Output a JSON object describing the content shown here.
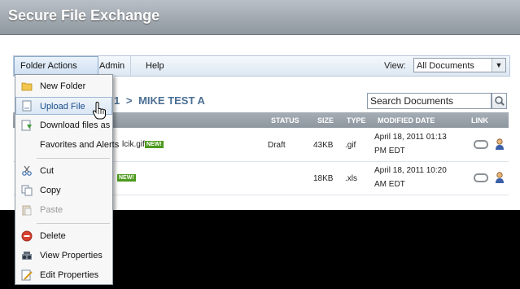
{
  "app": {
    "title": "Secure File Exchange"
  },
  "menubar": {
    "items": [
      {
        "label": "Folder Actions"
      },
      {
        "label": "Admin"
      },
      {
        "label": "Help"
      }
    ],
    "view_label": "View:",
    "view_selected": "All Documents"
  },
  "breadcrumb": {
    "part1": "1",
    "sep": ">",
    "folder": "MIKE TEST A"
  },
  "search": {
    "value": "Search Documents"
  },
  "table": {
    "headers": {
      "status": "STATUS",
      "size": "SIZE",
      "type": "TYPE",
      "modified": "MODIFIED DATE",
      "link": "LINK"
    },
    "rows": [
      {
        "name_fragment": "lcik.gif",
        "badge": "NEW!",
        "status": "Draft",
        "size": "43KB",
        "type": ".gif",
        "date1": "April 18, 2011 01:13",
        "date2": "PM EDT"
      },
      {
        "name_fragment": "",
        "badge": "NEW!",
        "status": "",
        "size": "18KB",
        "type": ".xls",
        "date1": "April 18, 2011 10:20",
        "date2": "AM EDT"
      }
    ]
  },
  "context_menu": {
    "items": [
      {
        "label": "New Folder",
        "icon": "folder-icon"
      },
      {
        "label": "Upload File",
        "icon": "document-icon"
      },
      {
        "label": "Download files as",
        "icon": "download-icon"
      },
      {
        "label": "Favorites and Alerts",
        "icon": "none"
      },
      {
        "label": "Cut",
        "icon": "scissors-icon"
      },
      {
        "label": "Copy",
        "icon": "copy-icon"
      },
      {
        "label": "Paste",
        "icon": "paste-icon",
        "disabled": true
      },
      {
        "label": "Delete",
        "icon": "delete-icon"
      },
      {
        "label": "View Properties",
        "icon": "view-properties-icon"
      },
      {
        "label": "Edit Properties",
        "icon": "edit-properties-icon"
      }
    ]
  },
  "colors": {
    "badge_green": "#4e9a1f",
    "path_blue": "#4b6f95",
    "header_gray": "#98a1a9"
  }
}
